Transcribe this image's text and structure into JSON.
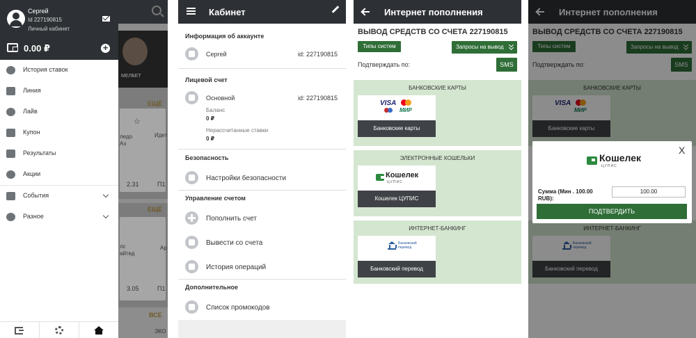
{
  "drawer": {
    "user_name": "Сергей",
    "user_id": "Id 227190815",
    "cabinet_link": "Личный кабинет",
    "balance": "0.00 ₽",
    "items": [
      {
        "label": "История ставок"
      },
      {
        "label": "Линия"
      },
      {
        "label": "Лайв"
      },
      {
        "label": "Купон"
      },
      {
        "label": "Результаты"
      },
      {
        "label": "Акции"
      },
      {
        "label": "События"
      },
      {
        "label": "Разное"
      }
    ]
  },
  "background_app": {
    "banner_text": "МЕЛБЕТ",
    "more_1": "ЕЩЁ",
    "more_2": "ЕЩЁ",
    "all": "ВСЕ",
    "snip_1": "ледо",
    "snip_2": "Аз",
    "snip_3": "Идет",
    "odd_1": "2.31",
    "p1_1": "П1",
    "snip_4": "лс",
    "snip_5": "айтед",
    "snip_6": "Ар",
    "odd_2": "3.05",
    "p1_2": "П1",
    "exo": "ЭКО"
  },
  "cabinet": {
    "title": "Кабинет",
    "account_info_header": "Информация об аккаунте",
    "user_name": "Сергей",
    "user_id": "id:  227190815",
    "personal_account_header": "Лицевой счет",
    "account_name": "Основной",
    "account_id": "id:  227190815",
    "balance_label": "Баланс",
    "balance_value": "0 ₽",
    "unsettled_label": "Нерассчитанные ставки",
    "unsettled_value": "0 ₽",
    "security_header": "Безопасность",
    "security_settings": "Настройки безопасности",
    "management_header": "Управление счетом",
    "topup": "Пополнить счет",
    "withdraw": "Вывести со счета",
    "history": "История операций",
    "additional_header": "Дополнительное",
    "promocodes": "Список промокодов"
  },
  "topup": {
    "title": "Интернет пополнения",
    "withdraw_title": "ВЫВОД СРЕДСТВ СО СЧЕТА 227190815",
    "system_types": "Типы систем",
    "withdraw_requests": "Запросы на вывод",
    "confirm_by": "Подтверждать по:",
    "sms": "SMS",
    "bank_cards_header": "БАНКОВСКИЕ КАРТЫ",
    "visa": "VISA",
    "mir": "МИР",
    "bank_cards_caption": "Банковские карты",
    "ewallets_header": "ЭЛЕКТРОННЫЕ КОШЕЛЬКИ",
    "koshelek": "Кошелек",
    "cupis": "ЦУПИС",
    "koshelek_caption": "Кошелек ЦУПИС",
    "ibank_header": "ИНТЕРНЕТ-БАНКИНГ",
    "bank_transfer_logo": "Банковский перевод",
    "bank_transfer_caption": "Банковский перевод"
  },
  "modal": {
    "close": "X",
    "koshelek": "Кошелек",
    "cupis": "ЦУПИС",
    "sum_label": "Сумма (Мин . 100.00 RUB):",
    "amount": "100.00",
    "confirm": "ПОДТВЕРДИТЬ"
  },
  "colors": {
    "dark_bar": "#2d3034",
    "accent_green": "#2f6e37",
    "section_green": "#d4e6d0"
  }
}
